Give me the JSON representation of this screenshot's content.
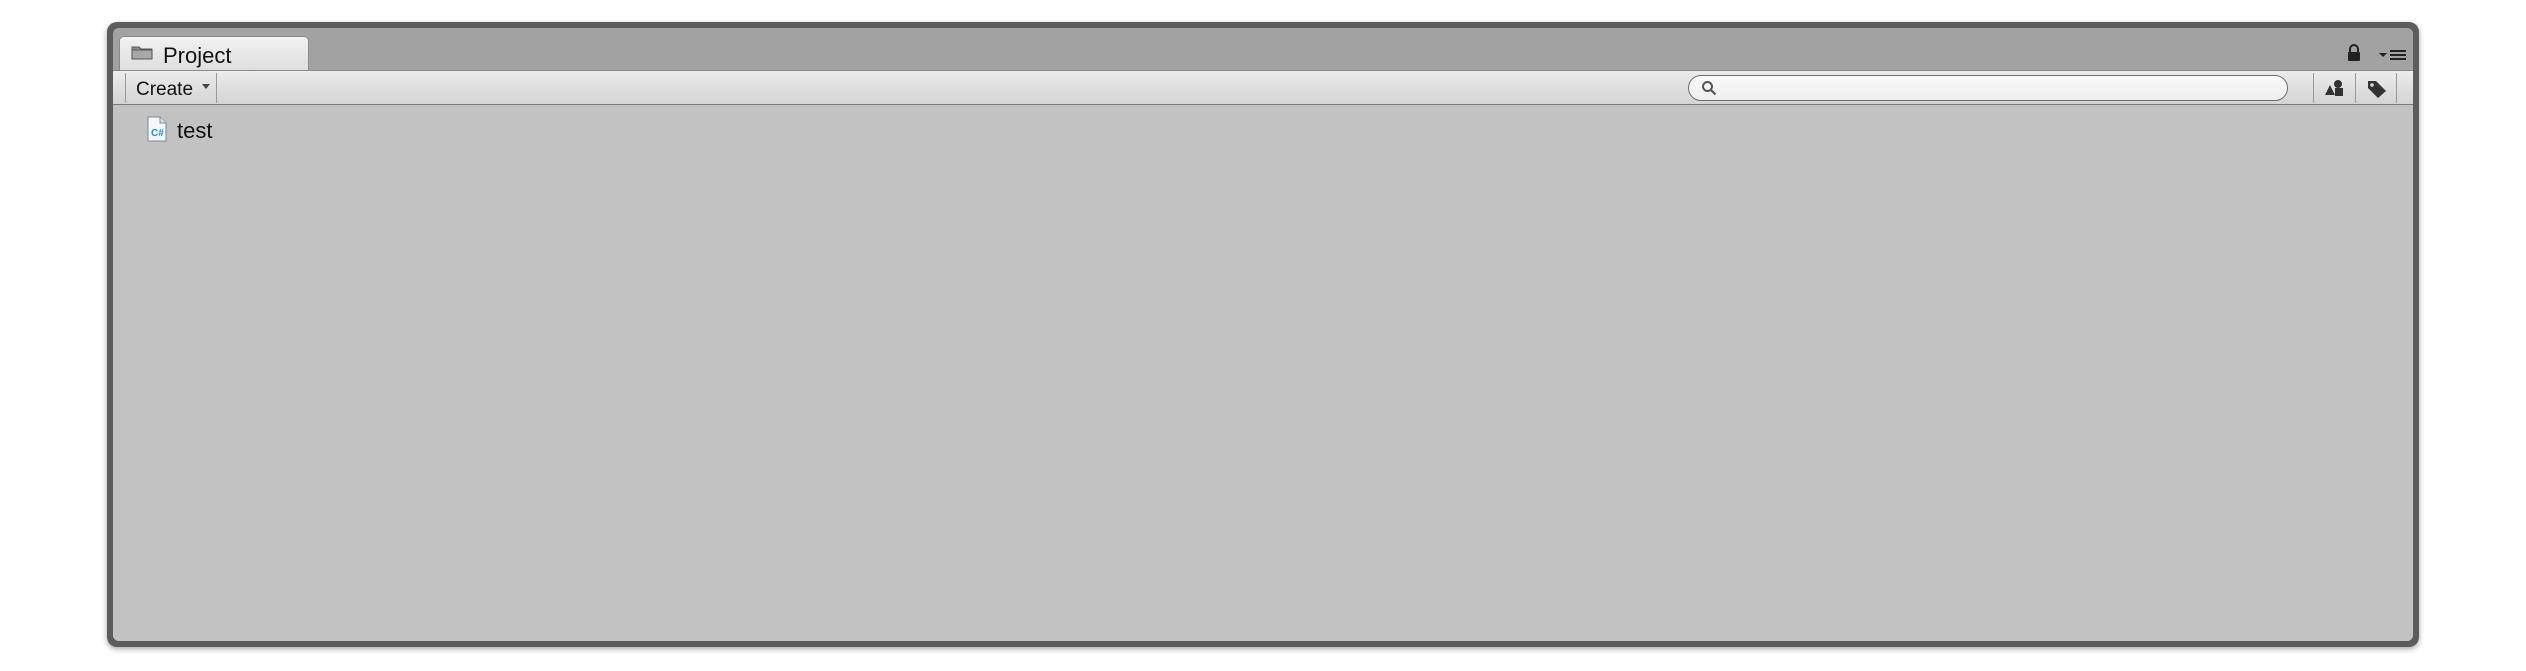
{
  "panel": {
    "tab_title": "Project",
    "tab_icon": "folder-icon"
  },
  "toolbar": {
    "create_label": "Create",
    "search_placeholder": "",
    "search_value": ""
  },
  "assets": [
    {
      "name": "test",
      "icon": "csharp-script-icon"
    }
  ],
  "colors": {
    "content_bg": "#c2c2c2",
    "toolbar_bg": "#dcdcdc",
    "frame": "#5c5c5c"
  }
}
